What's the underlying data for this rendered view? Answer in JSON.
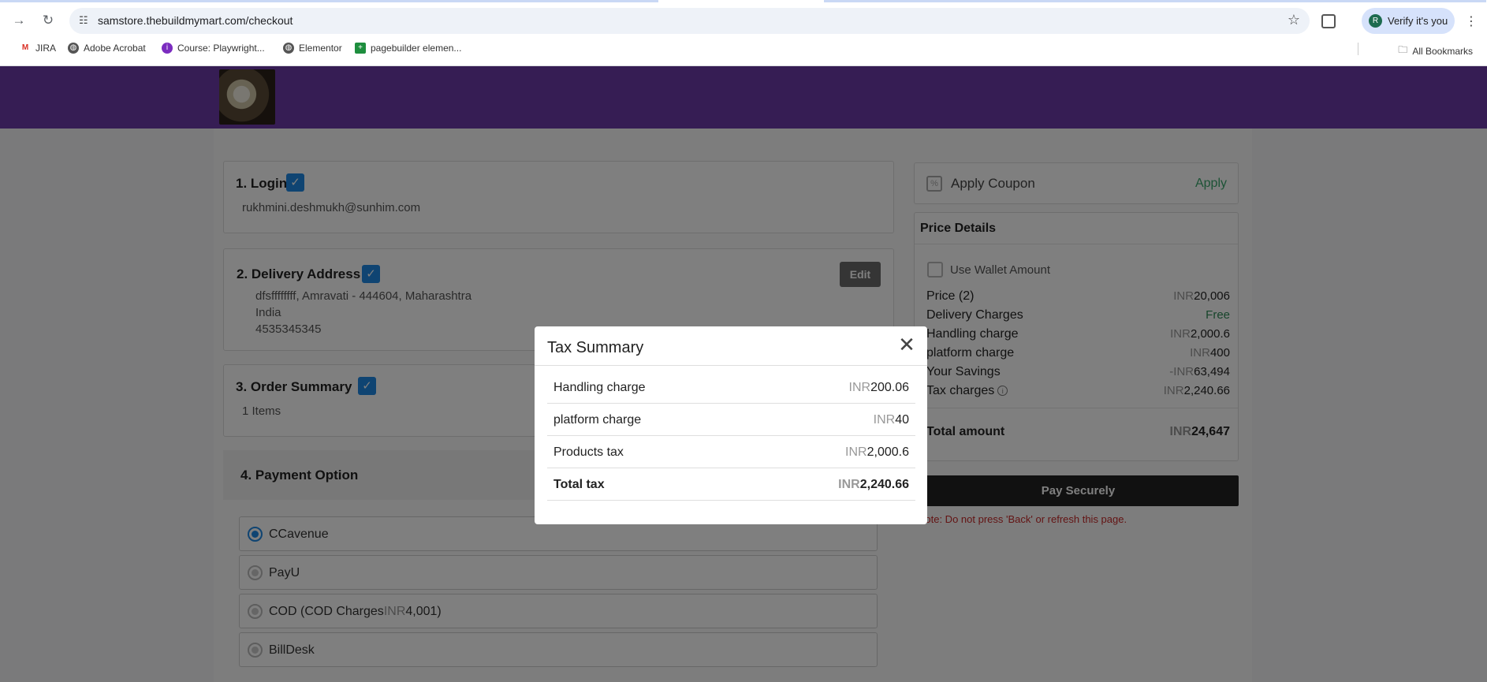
{
  "browser": {
    "url": "samstore.thebuildmymart.com/checkout",
    "profile_button": "Verify it's you",
    "profile_initial": "R",
    "bookmarks": [
      "JIRA",
      "Adobe Acrobat",
      "Course: Playwright...",
      "Elementor",
      "pagebuilder elemen..."
    ],
    "all_bookmarks": "All Bookmarks"
  },
  "checkout": {
    "login": {
      "title": "1. Login",
      "email": "rukhmini.deshmukh@sunhim.com"
    },
    "delivery": {
      "title": "2. Delivery Address",
      "edit_label": "Edit",
      "line1": "dfsffffffff, Amravati - 444604, Maharashtra",
      "line2": "India",
      "phone": "4535345345"
    },
    "order_summary": {
      "title": "3. Order Summary",
      "items": "1 Items"
    },
    "payment": {
      "title": "4. Payment Option",
      "options": [
        {
          "label": "CCavenue",
          "selected": true
        },
        {
          "label": "PayU",
          "selected": false
        },
        {
          "label": "COD (COD Charges",
          "currency": "INR",
          "amount": "4,001)",
          "selected": false
        },
        {
          "label": "BillDesk",
          "selected": false
        }
      ]
    }
  },
  "sidebar": {
    "coupon": {
      "label": "Apply Coupon",
      "apply": "Apply"
    },
    "price_details": {
      "title": "Price Details",
      "wallet_label": "Use Wallet Amount",
      "rows": [
        {
          "label": "Price (2)",
          "currency": "INR",
          "value": "20,006"
        },
        {
          "label": "Delivery Charges",
          "currency": "",
          "value": "Free"
        },
        {
          "label": "Handling charge",
          "currency": "INR",
          "value": "2,000.6"
        },
        {
          "label": "platform charge",
          "currency": "INR",
          "value": "400"
        },
        {
          "label": "Your Savings",
          "currency": "-INR",
          "value": "63,494"
        },
        {
          "label": "Tax charges",
          "currency": "INR",
          "value": "2,240.66"
        }
      ],
      "total_label": "Total amount",
      "total_currency": "INR",
      "total_value": "24,647"
    },
    "pay_button": "Pay Securely",
    "note": "Note: Do not press 'Back' or refresh this page."
  },
  "tax_modal": {
    "title": "Tax Summary",
    "rows": [
      {
        "label": "Handling charge",
        "currency": "INR",
        "value": "200.06"
      },
      {
        "label": "platform charge",
        "currency": "INR",
        "value": "40"
      },
      {
        "label": "Products tax",
        "currency": "INR",
        "value": "2,000.6"
      }
    ],
    "total_label": "Total tax",
    "total_currency": "INR",
    "total_value": "2,240.66"
  },
  "colors": {
    "header": "#6c3aa8",
    "accent": "#1e88e5",
    "apply": "#3aa76d",
    "note": "#c62828"
  }
}
